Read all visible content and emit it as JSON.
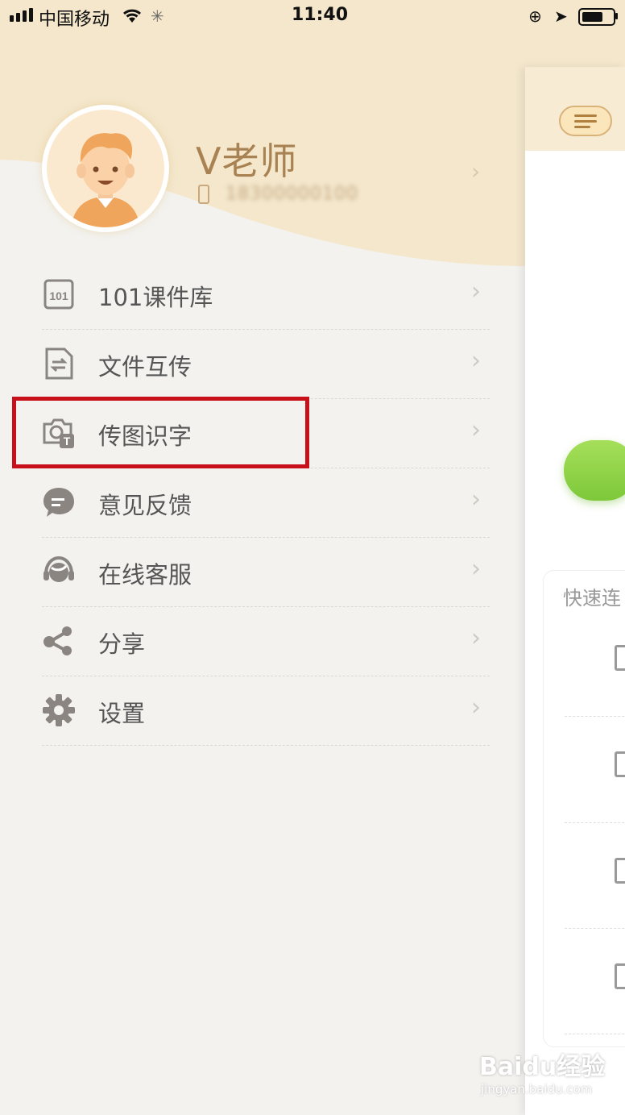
{
  "status_bar": {
    "carrier": "中国移动",
    "time": "11:40"
  },
  "profile": {
    "name": "V老师",
    "phone": "18300000100"
  },
  "menu": [
    {
      "label": "101课件库",
      "icon": "courseware-library-icon"
    },
    {
      "label": "文件互传",
      "icon": "file-transfer-icon"
    },
    {
      "label": "传图识字",
      "icon": "image-text-recognition-icon"
    },
    {
      "label": "意见反馈",
      "icon": "feedback-bubble-icon"
    },
    {
      "label": "在线客服",
      "icon": "customer-service-headset-icon"
    },
    {
      "label": "分享",
      "icon": "share-icon"
    },
    {
      "label": "设置",
      "icon": "settings-gear-icon"
    }
  ],
  "main_panel": {
    "quick_connect_title": "快速连"
  },
  "watermark": {
    "brand": "Baidu经验",
    "url": "jingyan.baidu.com"
  },
  "colors": {
    "header_bg": "#f4e7cc",
    "accent_text": "#a88252",
    "highlight_border": "#c8101a",
    "green_button": "#8ed14a"
  }
}
